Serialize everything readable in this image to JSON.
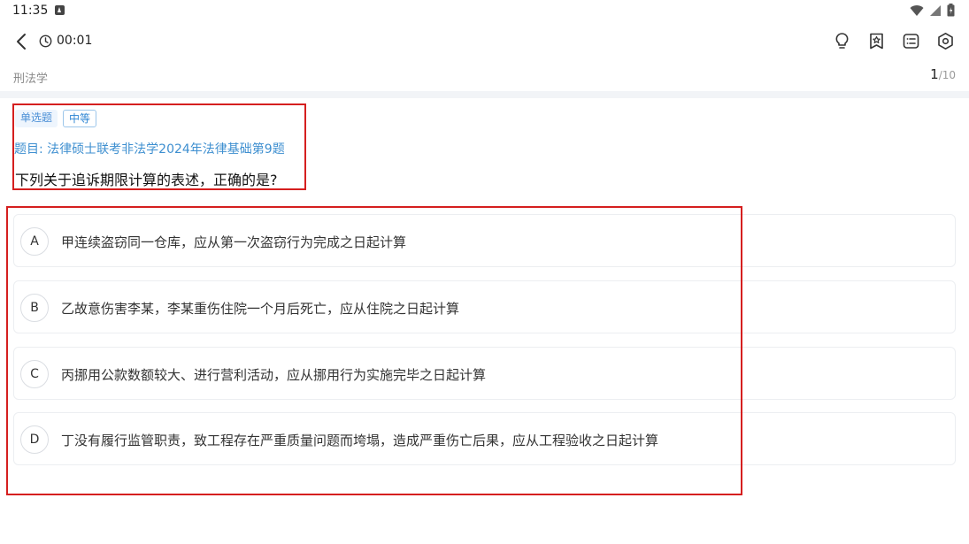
{
  "status_bar": {
    "time": "11:35",
    "icons": [
      "app-notification-icon",
      "wifi-icon",
      "signal-icon",
      "battery-icon"
    ]
  },
  "header": {
    "timer": "00:01",
    "icons": [
      "back-icon",
      "clock-icon",
      "hint-bulb-icon",
      "favorite-star-icon",
      "answer-sheet-icon",
      "settings-icon"
    ]
  },
  "subheader": {
    "subject": "刑法学",
    "progress_current": "1",
    "progress_total": "/10"
  },
  "question": {
    "type_tag": "单选题",
    "difficulty_tag": "中等",
    "source": "题目: 法律硕士联考非法学2024年法律基础第9题",
    "stem": "下列关于追诉期限计算的表述，正确的是?"
  },
  "options": [
    {
      "letter": "A",
      "text": "甲连续盗窃同一仓库，应从第一次盗窃行为完成之日起计算"
    },
    {
      "letter": "B",
      "text": "乙故意伤害李某，李某重伤住院一个月后死亡，应从住院之日起计算"
    },
    {
      "letter": "C",
      "text": "丙挪用公款数额较大、进行营利活动，应从挪用行为实施完毕之日起计算"
    },
    {
      "letter": "D",
      "text": "丁没有履行监管职责，致工程存在严重质量问题而垮塌，造成严重伤亡后果，应从工程验收之日起计算"
    }
  ],
  "colors": {
    "accent_blue": "#3e8fd0",
    "annotation_red": "#d51f1f",
    "muted_gray": "#8a8a8a"
  }
}
